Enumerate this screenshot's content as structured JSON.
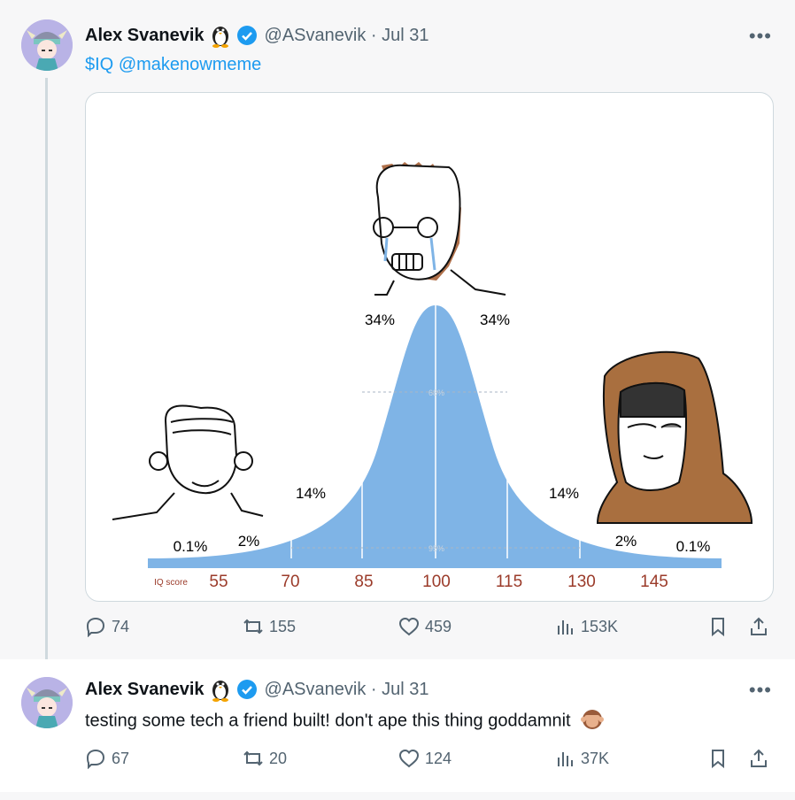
{
  "tweets": [
    {
      "author_name": "Alex Svanevik",
      "handle_date": "@ASvanevik · Jul 31",
      "text_cashtag": "$IQ",
      "text_mention": "@makenowmeme",
      "chart_labels": [
        "34%",
        "34%",
        "14%",
        "14%",
        "2%",
        "2%",
        "0.1%",
        "0.1%"
      ],
      "chart_inner": [
        "68%",
        "95%"
      ],
      "iq_caption": "IQ score",
      "iq_ticks": [
        "55",
        "70",
        "85",
        "100",
        "115",
        "130",
        "145"
      ],
      "stats": {
        "replies": "74",
        "reposts": "155",
        "likes": "459",
        "views": "153K"
      }
    },
    {
      "author_name": "Alex Svanevik",
      "handle_date": "@ASvanevik · Jul 31",
      "text": "testing some tech a friend built! don't ape this thing goddamnit",
      "stats": {
        "replies": "67",
        "reposts": "20",
        "likes": "124",
        "views": "37K"
      }
    }
  ],
  "colors": {
    "accent": "#1d9bf0",
    "muted": "#536471",
    "curve": "#7fb4e6",
    "tick": "#9b3b2a"
  },
  "icons": [
    "penguin-icon",
    "verified-icon",
    "more-icon",
    "reply-icon",
    "repost-icon",
    "like-icon",
    "views-icon",
    "bookmark-icon",
    "share-icon",
    "see-no-evil-monkey-icon"
  ]
}
